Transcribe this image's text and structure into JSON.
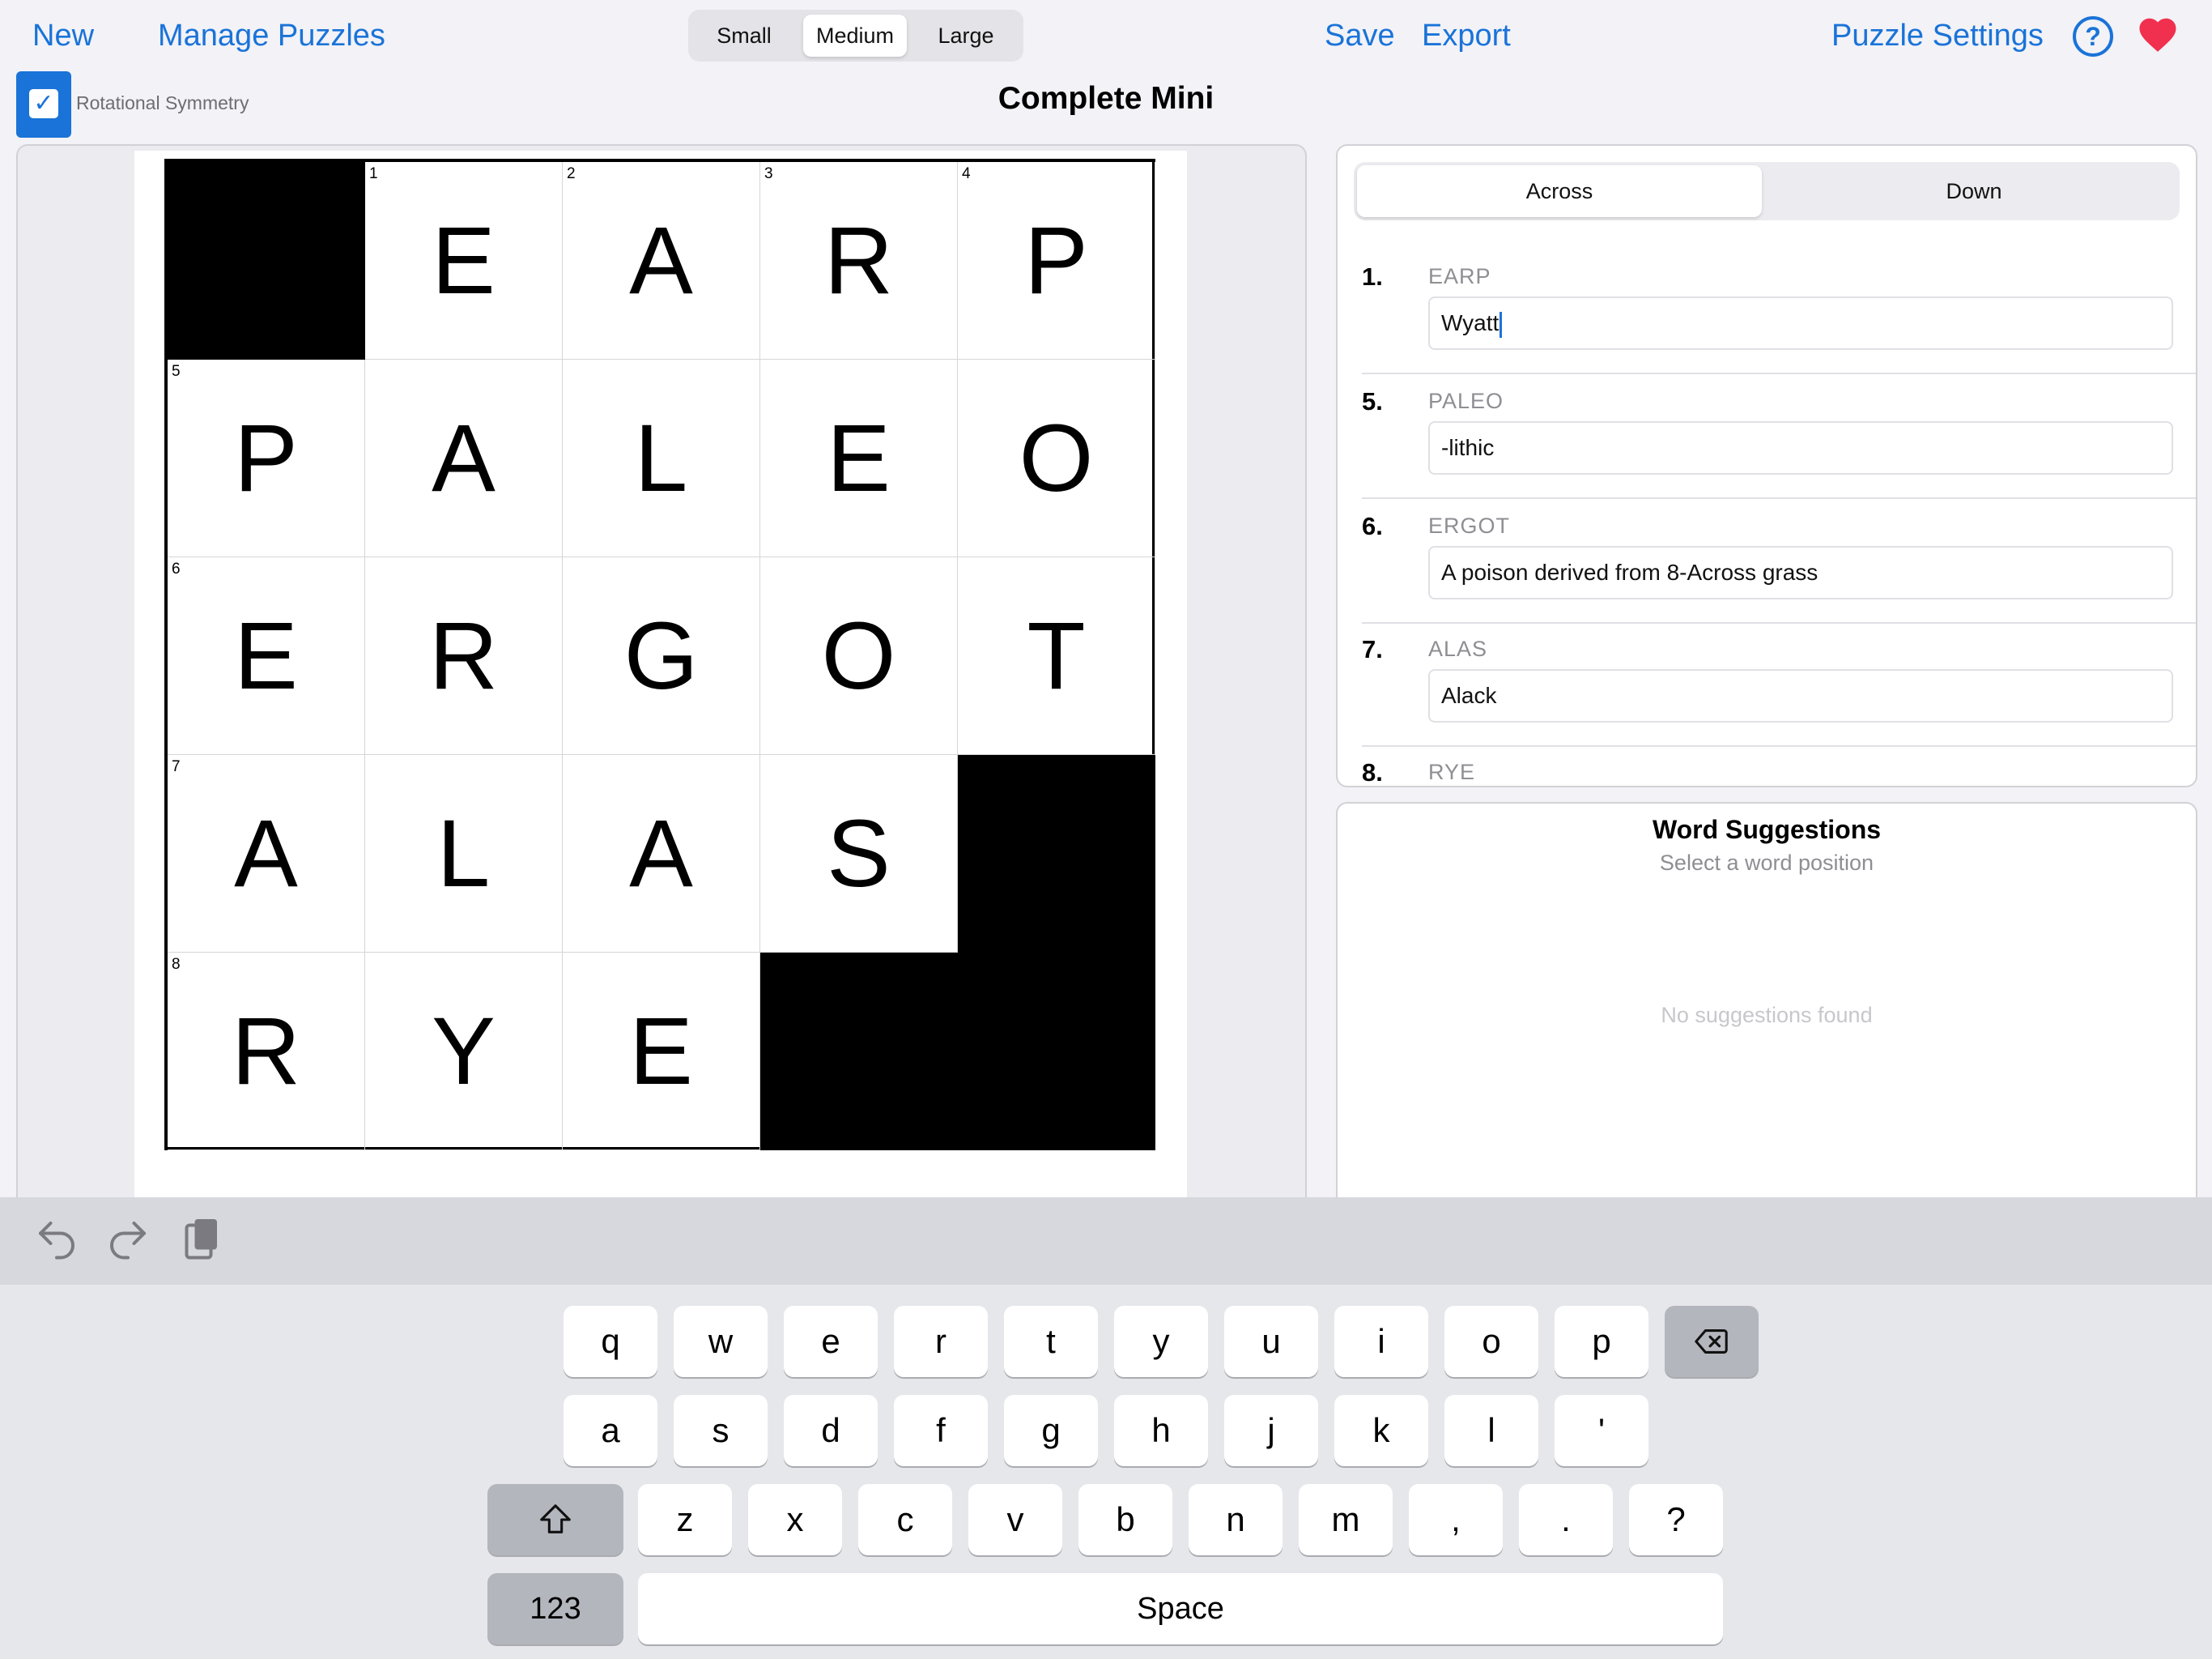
{
  "toolbar": {
    "new_label": "New",
    "manage_label": "Manage Puzzles",
    "size_options": [
      "Small",
      "Medium",
      "Large"
    ],
    "size_selected": "Medium",
    "save_label": "Save",
    "export_label": "Export",
    "settings_label": "Puzzle Settings",
    "help_label": "?"
  },
  "symmetry": {
    "label": "Rotational Symmetry",
    "checked": true,
    "check_glyph": "✓"
  },
  "puzzle": {
    "title": "Complete Mini",
    "grid": [
      [
        "#",
        "E",
        "A",
        "R",
        "P"
      ],
      [
        "P",
        "A",
        "L",
        "E",
        "O"
      ],
      [
        "E",
        "R",
        "G",
        "O",
        "T"
      ],
      [
        "A",
        "L",
        "A",
        "S",
        "#"
      ],
      [
        "R",
        "Y",
        "E",
        "#",
        "#"
      ]
    ],
    "numbers": [
      [
        null,
        "1",
        "2",
        "3",
        "4"
      ],
      [
        "5",
        null,
        null,
        null,
        null
      ],
      [
        "6",
        null,
        null,
        null,
        null
      ],
      [
        "7",
        null,
        null,
        null,
        null
      ],
      [
        "8",
        null,
        null,
        null,
        null
      ]
    ]
  },
  "clues": {
    "tabs": [
      "Across",
      "Down"
    ],
    "selected_tab": "Across",
    "across": [
      {
        "num": "1.",
        "answer": "EARP",
        "clue": "Wyatt"
      },
      {
        "num": "5.",
        "answer": "PALEO",
        "clue": "-lithic"
      },
      {
        "num": "6.",
        "answer": "ERGOT",
        "clue": "A poison derived from 8-Across grass"
      },
      {
        "num": "7.",
        "answer": "ALAS",
        "clue": "Alack"
      },
      {
        "num": "8.",
        "answer": "RYE",
        "clue": ""
      }
    ]
  },
  "suggestions": {
    "title": "Word Suggestions",
    "subtitle": "Select a word position",
    "empty": "No suggestions found"
  },
  "keyboard": {
    "row1": [
      "q",
      "w",
      "e",
      "r",
      "t",
      "y",
      "u",
      "i",
      "o",
      "p"
    ],
    "row2": [
      "a",
      "s",
      "d",
      "f",
      "g",
      "h",
      "j",
      "k",
      "l",
      "'"
    ],
    "row3": [
      "z",
      "x",
      "c",
      "v",
      "b",
      "n",
      "m",
      ",",
      ".",
      "?"
    ],
    "numbers_label": "123",
    "space_label": "Space"
  },
  "colors": {
    "accent": "#1a73d8",
    "heart": "#f0304e",
    "black_square": "#000000"
  }
}
